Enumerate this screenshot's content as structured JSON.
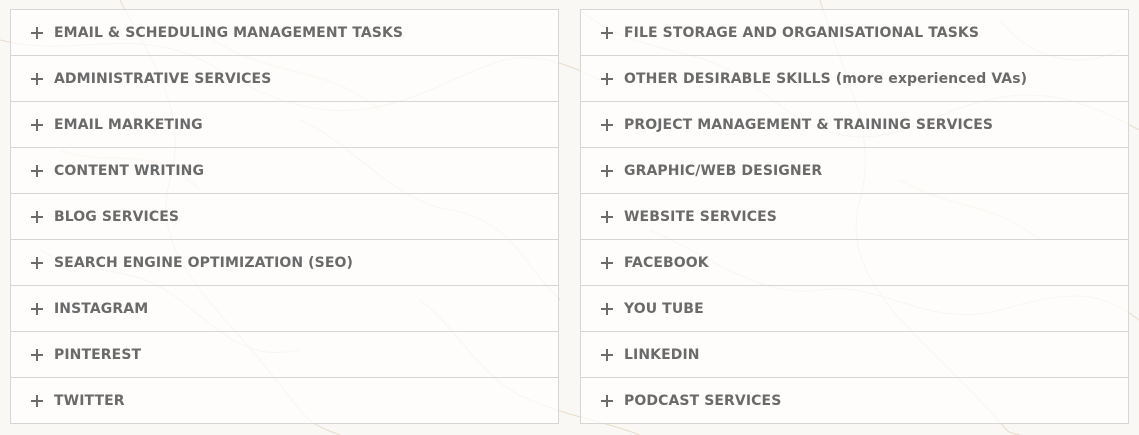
{
  "left_column": {
    "items": [
      {
        "label": "EMAIL & SCHEDULING MANAGEMENT TASKS"
      },
      {
        "label": "ADMINISTRATIVE SERVICES"
      },
      {
        "label": "EMAIL MARKETING"
      },
      {
        "label": "CONTENT WRITING"
      },
      {
        "label": "BLOG SERVICES"
      },
      {
        "label": "SEARCH ENGINE OPTIMIZATION (SEO)"
      },
      {
        "label": "INSTAGRAM"
      },
      {
        "label": "PINTEREST"
      },
      {
        "label": "TWITTER"
      }
    ]
  },
  "right_column": {
    "items": [
      {
        "label": "FILE STORAGE AND ORGANISATIONAL TASKS"
      },
      {
        "label": "OTHER DESIRABLE SKILLS (more experienced VAs)"
      },
      {
        "label": "PROJECT MANAGEMENT & TRAINING SERVICES"
      },
      {
        "label": "GRAPHIC/WEB DESIGNER"
      },
      {
        "label": "WEBSITE SERVICES"
      },
      {
        "label": "FACEBOOK"
      },
      {
        "label": "YOU TUBE"
      },
      {
        "label": "LINKEDIN"
      },
      {
        "label": "PODCAST SERVICES"
      }
    ]
  },
  "icons": {
    "expand": "plus-icon"
  },
  "colors": {
    "label_text": "#6a6a6a",
    "border": "#d6d6d6",
    "background": "#faf8f5"
  }
}
